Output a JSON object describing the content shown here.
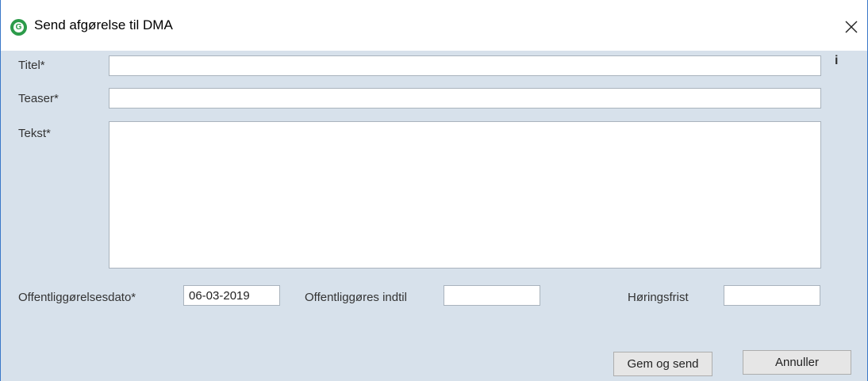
{
  "window": {
    "title": "Send afgørelse til DMA",
    "app_icon_letter": "G"
  },
  "form": {
    "titel": {
      "label": "Titel*",
      "value": ""
    },
    "teaser": {
      "label": "Teaser*",
      "value": ""
    },
    "tekst": {
      "label": "Tekst*",
      "value": ""
    },
    "offentliggoerelsesdato": {
      "label": "Offentliggørelsesdato*",
      "value": "06-03-2019"
    },
    "offentliggoeres_indtil": {
      "label": "Offentliggøres indtil",
      "value": ""
    },
    "hoeringsfrist": {
      "label": "Høringsfrist",
      "value": ""
    },
    "info_symbol": "i"
  },
  "buttons": {
    "save_send": "Gem og send",
    "cancel": "Annuller"
  }
}
